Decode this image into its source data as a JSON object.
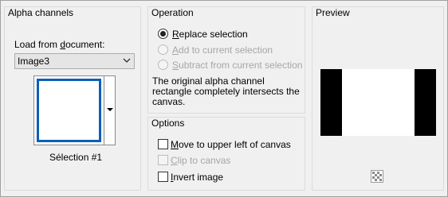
{
  "alpha_channels": {
    "title": "Alpha channels",
    "load_label_pre": "Load from ",
    "load_label_u": "d",
    "load_label_post": "ocument:",
    "document_value": "Image3",
    "selection_name": "Sélection #1"
  },
  "operation": {
    "title": "Operation",
    "options": [
      {
        "u": "R",
        "rest": "eplace selection",
        "checked": true,
        "enabled": true
      },
      {
        "u": "A",
        "rest": "dd to current selection",
        "checked": false,
        "enabled": false
      },
      {
        "u": "S",
        "rest": "ubtract from current selection",
        "checked": false,
        "enabled": false
      }
    ],
    "description_lines": [
      "The original alpha channel",
      "rectangle completely intersects the",
      "canvas."
    ]
  },
  "options": {
    "title": "Options",
    "items": [
      {
        "u": "M",
        "rest": "ove to upper left of canvas",
        "checked": false,
        "enabled": true
      },
      {
        "u": "C",
        "rest": "lip to canvas",
        "checked": false,
        "enabled": false
      },
      {
        "u": "I",
        "rest": "nvert image",
        "checked": false,
        "enabled": true
      }
    ]
  },
  "preview": {
    "title": "Preview"
  }
}
